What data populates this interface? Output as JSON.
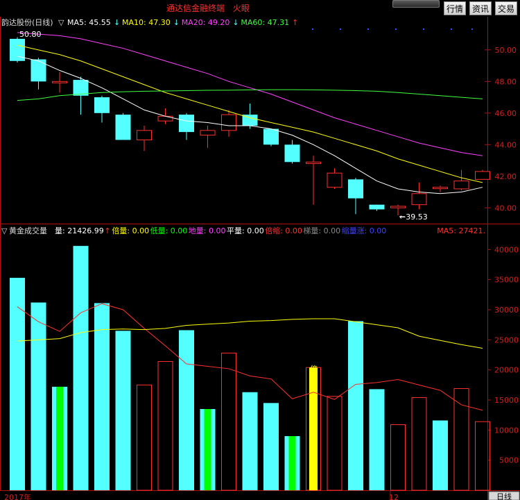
{
  "app": {
    "title": "通达信金融终端",
    "subtitle": "火眼",
    "buttons": [
      "行情",
      "资讯",
      "交易"
    ]
  },
  "price_panel": {
    "stock_name": "韵达股份(日线)",
    "ma_indicators": [
      {
        "label": "MA5: 45.55",
        "arrow": "↓",
        "color": "#ffffff"
      },
      {
        "label": "MA10: 47.30",
        "arrow": "↓",
        "color": "#ffff00"
      },
      {
        "label": "MA20: 49.20",
        "arrow": "↓",
        "color": "#ff40ff"
      },
      {
        "label": "MA60: 47.31",
        "arrow": "↑",
        "color": "#40ff40"
      }
    ],
    "high_label": "50.80",
    "low_label": "39.53"
  },
  "volume_panel": {
    "indicator_name": "黄金成交量",
    "stats": [
      {
        "label": "量: 21426.99",
        "arrow": "↑",
        "color": "#ffffff"
      },
      {
        "label": "倍量: 0.00",
        "color": "#ffff00"
      },
      {
        "label": "低量: 0.00",
        "color": "#00ff00"
      },
      {
        "label": "地量: 0.00",
        "color": "#ff40ff"
      },
      {
        "label": "平量: 0.00",
        "color": "#ffffff"
      },
      {
        "label": "倍缩: 0.00",
        "color": "#ff3030"
      },
      {
        "label": "梯量: 0.00",
        "color": "#888888"
      },
      {
        "label": "缩量涨: 0.00",
        "color": "#4040ff"
      }
    ],
    "ma5_label": "MA5: 27421.",
    "marker_text": "倍"
  },
  "bottom": {
    "date_left": "2017年",
    "date_mid": "12",
    "period_button": "日线"
  },
  "chart_data": [
    {
      "type": "candlestick",
      "title": "韵达股份(日线)",
      "y_ticks": [
        40.0,
        42.0,
        44.0,
        46.0,
        48.0,
        50.0
      ],
      "ylim": [
        39.0,
        51.4
      ],
      "candles": [
        {
          "o": 50.7,
          "h": 50.8,
          "l": 49.2,
          "c": 49.3
        },
        {
          "o": 49.4,
          "h": 49.5,
          "l": 47.5,
          "c": 48.0
        },
        {
          "o": 48.0,
          "h": 48.6,
          "l": 47.3,
          "c": 48.0
        },
        {
          "o": 48.1,
          "h": 48.3,
          "l": 45.9,
          "c": 47.1
        },
        {
          "o": 47.0,
          "h": 47.1,
          "l": 45.4,
          "c": 46.0
        },
        {
          "o": 45.9,
          "h": 46.0,
          "l": 44.3,
          "c": 44.3
        },
        {
          "o": 44.3,
          "h": 45.2,
          "l": 43.6,
          "c": 44.9
        },
        {
          "o": 45.5,
          "h": 46.3,
          "l": 45.3,
          "c": 45.8
        },
        {
          "o": 45.9,
          "h": 46.0,
          "l": 44.3,
          "c": 44.8
        },
        {
          "o": 44.6,
          "h": 45.2,
          "l": 43.8,
          "c": 44.9
        },
        {
          "o": 44.9,
          "h": 46.2,
          "l": 44.5,
          "c": 45.9
        },
        {
          "o": 45.9,
          "h": 46.6,
          "l": 45.0,
          "c": 45.2
        },
        {
          "o": 45.0,
          "h": 45.0,
          "l": 43.9,
          "c": 44.0
        },
        {
          "o": 44.0,
          "h": 44.3,
          "l": 42.8,
          "c": 42.9
        },
        {
          "o": 42.8,
          "h": 43.3,
          "l": 40.2,
          "c": 42.9
        },
        {
          "o": 41.3,
          "h": 42.5,
          "l": 41.2,
          "c": 42.2
        },
        {
          "o": 41.8,
          "h": 41.9,
          "l": 39.6,
          "c": 40.6
        },
        {
          "o": 40.2,
          "h": 40.2,
          "l": 39.8,
          "c": 39.9
        },
        {
          "o": 40.0,
          "h": 40.2,
          "l": 39.53,
          "c": 40.1
        },
        {
          "o": 40.2,
          "h": 41.6,
          "l": 39.9,
          "c": 40.9
        },
        {
          "o": 41.3,
          "h": 41.4,
          "l": 41.0,
          "c": 41.3
        },
        {
          "o": 41.2,
          "h": 42.4,
          "l": 41.1,
          "c": 41.7
        },
        {
          "o": 41.8,
          "h": 42.4,
          "l": 41.8,
          "c": 42.3
        }
      ],
      "ma_series": [
        {
          "name": "MA5",
          "color": "#ffffff",
          "values": [
            49.6,
            49.3,
            48.7,
            48.2,
            47.6,
            46.9,
            46.2,
            45.8,
            45.5,
            45.4,
            45.2,
            45.2,
            45.0,
            44.6,
            44.0,
            43.3,
            42.5,
            41.7,
            41.2,
            41.0,
            40.9,
            41.0,
            41.3
          ]
        },
        {
          "name": "MA10",
          "color": "#ffff00",
          "values": [
            50.3,
            50.0,
            49.7,
            49.3,
            48.8,
            48.3,
            47.8,
            47.3,
            46.9,
            46.5,
            46.1,
            45.7,
            45.4,
            45.1,
            44.8,
            44.4,
            44.0,
            43.6,
            43.1,
            42.7,
            42.3,
            41.9,
            41.6
          ]
        },
        {
          "name": "MA20",
          "color": "#ff40ff",
          "values": [
            51.1,
            51.0,
            50.9,
            50.7,
            50.4,
            50.1,
            49.7,
            49.3,
            48.9,
            48.5,
            48.0,
            47.6,
            47.2,
            46.7,
            46.2,
            45.7,
            45.3,
            44.9,
            44.5,
            44.1,
            43.8,
            43.5,
            43.3
          ]
        },
        {
          "name": "MA60",
          "color": "#40ff40",
          "values": [
            46.8,
            46.9,
            47.1,
            47.2,
            47.3,
            47.35,
            47.38,
            47.4,
            47.42,
            47.44,
            47.45,
            47.47,
            47.48,
            47.48,
            47.47,
            47.45,
            47.42,
            47.38,
            47.3,
            47.2,
            47.1,
            47.0,
            46.9
          ]
        }
      ]
    },
    {
      "type": "bar",
      "title": "黄金成交量",
      "y_ticks": [
        5000,
        10000,
        15000,
        20000,
        25000,
        30000,
        35000,
        40000
      ],
      "ylim": [
        0,
        42000
      ],
      "bars": [
        {
          "v": 35300,
          "style": "cyan"
        },
        {
          "v": 31200,
          "style": "cyan"
        },
        {
          "v": 17200,
          "style": "cyan-green"
        },
        {
          "v": 40600,
          "style": "cyan"
        },
        {
          "v": 31100,
          "style": "cyan"
        },
        {
          "v": 26500,
          "style": "cyan"
        },
        {
          "v": 17500,
          "style": "red"
        },
        {
          "v": 21400,
          "style": "red"
        },
        {
          "v": 26600,
          "style": "cyan"
        },
        {
          "v": 13500,
          "style": "cyan-green"
        },
        {
          "v": 22800,
          "style": "red"
        },
        {
          "v": 16300,
          "style": "cyan"
        },
        {
          "v": 14500,
          "style": "cyan"
        },
        {
          "v": 9000,
          "style": "cyan-green"
        },
        {
          "v": 20400,
          "style": "red-yellow"
        },
        {
          "v": 15600,
          "style": "red"
        },
        {
          "v": 28100,
          "style": "cyan"
        },
        {
          "v": 16800,
          "style": "cyan"
        },
        {
          "v": 10900,
          "style": "red"
        },
        {
          "v": 15400,
          "style": "red"
        },
        {
          "v": 11600,
          "style": "cyan"
        },
        {
          "v": 16900,
          "style": "red"
        },
        {
          "v": 11400,
          "style": "red"
        }
      ],
      "lines": [
        {
          "name": "MA5",
          "color": "#ff3030",
          "values": [
            30500,
            28000,
            26400,
            29500,
            31000,
            30000,
            26900,
            24000,
            21000,
            20600,
            20200,
            19000,
            18500,
            15200,
            16300,
            15100,
            17600,
            17900,
            18400,
            17500,
            16600,
            14200,
            13300
          ]
        },
        {
          "name": "MA10",
          "color": "#ffff00",
          "values": [
            24800,
            25000,
            25200,
            26200,
            26700,
            26800,
            26700,
            26900,
            27400,
            27600,
            27800,
            28100,
            28200,
            28400,
            28500,
            28500,
            28000,
            27500,
            27000,
            25600,
            24900,
            24200,
            23600
          ]
        }
      ]
    }
  ]
}
